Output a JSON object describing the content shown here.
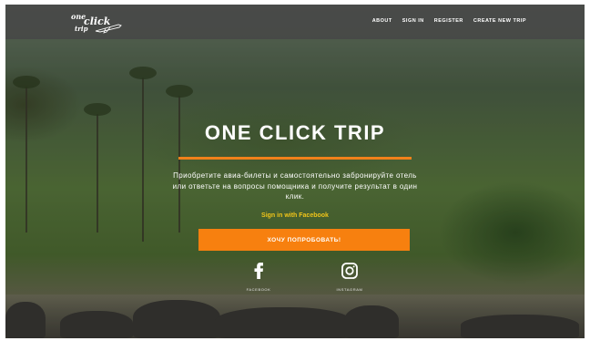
{
  "brand": {
    "logo_word1": "one",
    "logo_word2": "click",
    "logo_word3": "trip"
  },
  "nav": {
    "items": [
      "ABOUT",
      "SIGN IN",
      "REGISTER",
      "CREATE NEW TRIP"
    ]
  },
  "hero": {
    "title": "ONE CLICK TRIP",
    "description": "Приобретите авиа-билеты и самостоятельно забронируйте отель или ответьте на вопросы помощника и получите результат в один клик.",
    "facebook_link": "Sign in with Facebook",
    "cta_label": "ХОЧУ ПОПРОБОВАТЬ!",
    "accent_color": "#f7800f"
  },
  "social": {
    "facebook": {
      "label": "FACEBOOK",
      "icon": "facebook-icon"
    },
    "instagram": {
      "label": "INSTAGRAM",
      "icon": "instagram-icon"
    }
  }
}
